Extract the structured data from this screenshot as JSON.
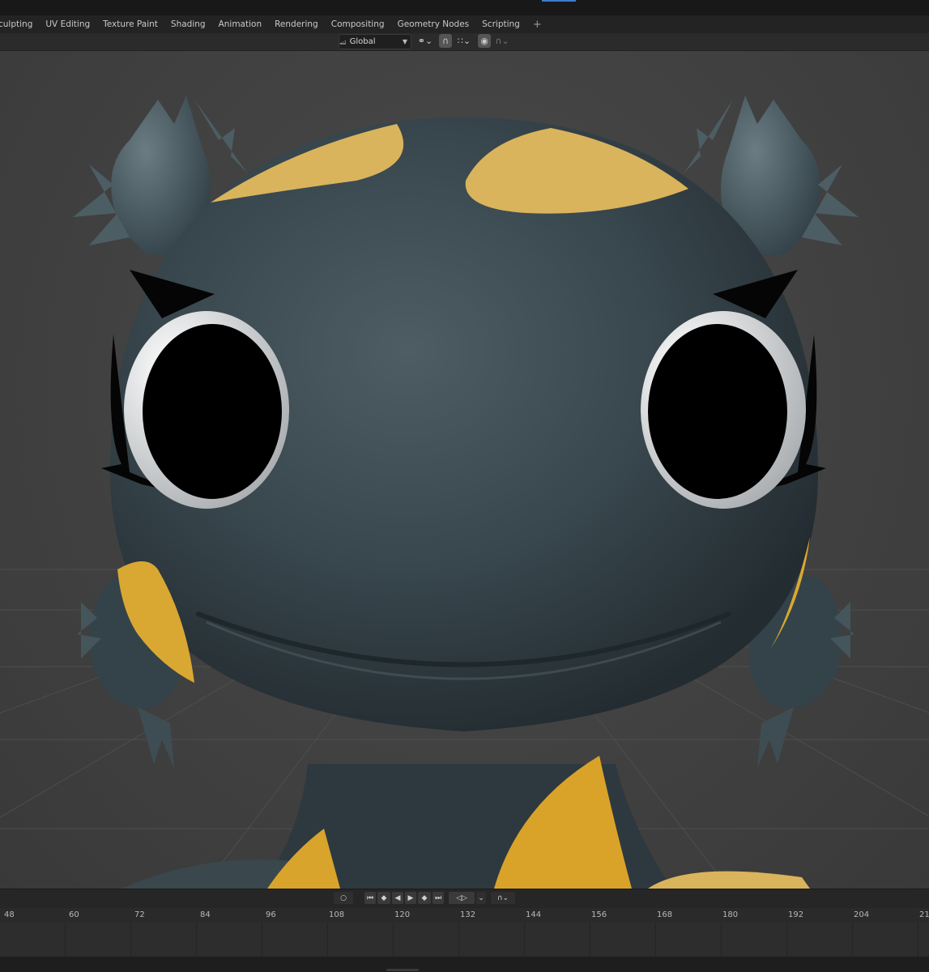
{
  "workspace_tabs": [
    {
      "label": "culpting"
    },
    {
      "label": "UV Editing"
    },
    {
      "label": "Texture Paint"
    },
    {
      "label": "Shading"
    },
    {
      "label": "Animation"
    },
    {
      "label": "Rendering"
    },
    {
      "label": "Compositing"
    },
    {
      "label": "Geometry Nodes"
    },
    {
      "label": "Scripting"
    },
    {
      "label": "+"
    }
  ],
  "header": {
    "orientation": "Global",
    "pivot_icon": "pivot-icon",
    "snap_icon": "magnet-icon",
    "proportional_icon": "proportional-editing-icon"
  },
  "playback": {
    "icons": [
      "jump-start-icon",
      "prev-keyframe-icon",
      "play-reverse-icon",
      "play-icon",
      "next-keyframe-icon",
      "jump-end-icon"
    ]
  },
  "timeline": {
    "frames": [
      "48",
      "60",
      "72",
      "84",
      "96",
      "108",
      "120",
      "132",
      "144",
      "156",
      "168",
      "180",
      "192",
      "204",
      "21"
    ]
  },
  "colors": {
    "skin": "#35424a",
    "spots": "#d9b45c",
    "viewport_bg": "#424242",
    "accent": "#3d7bd1"
  }
}
